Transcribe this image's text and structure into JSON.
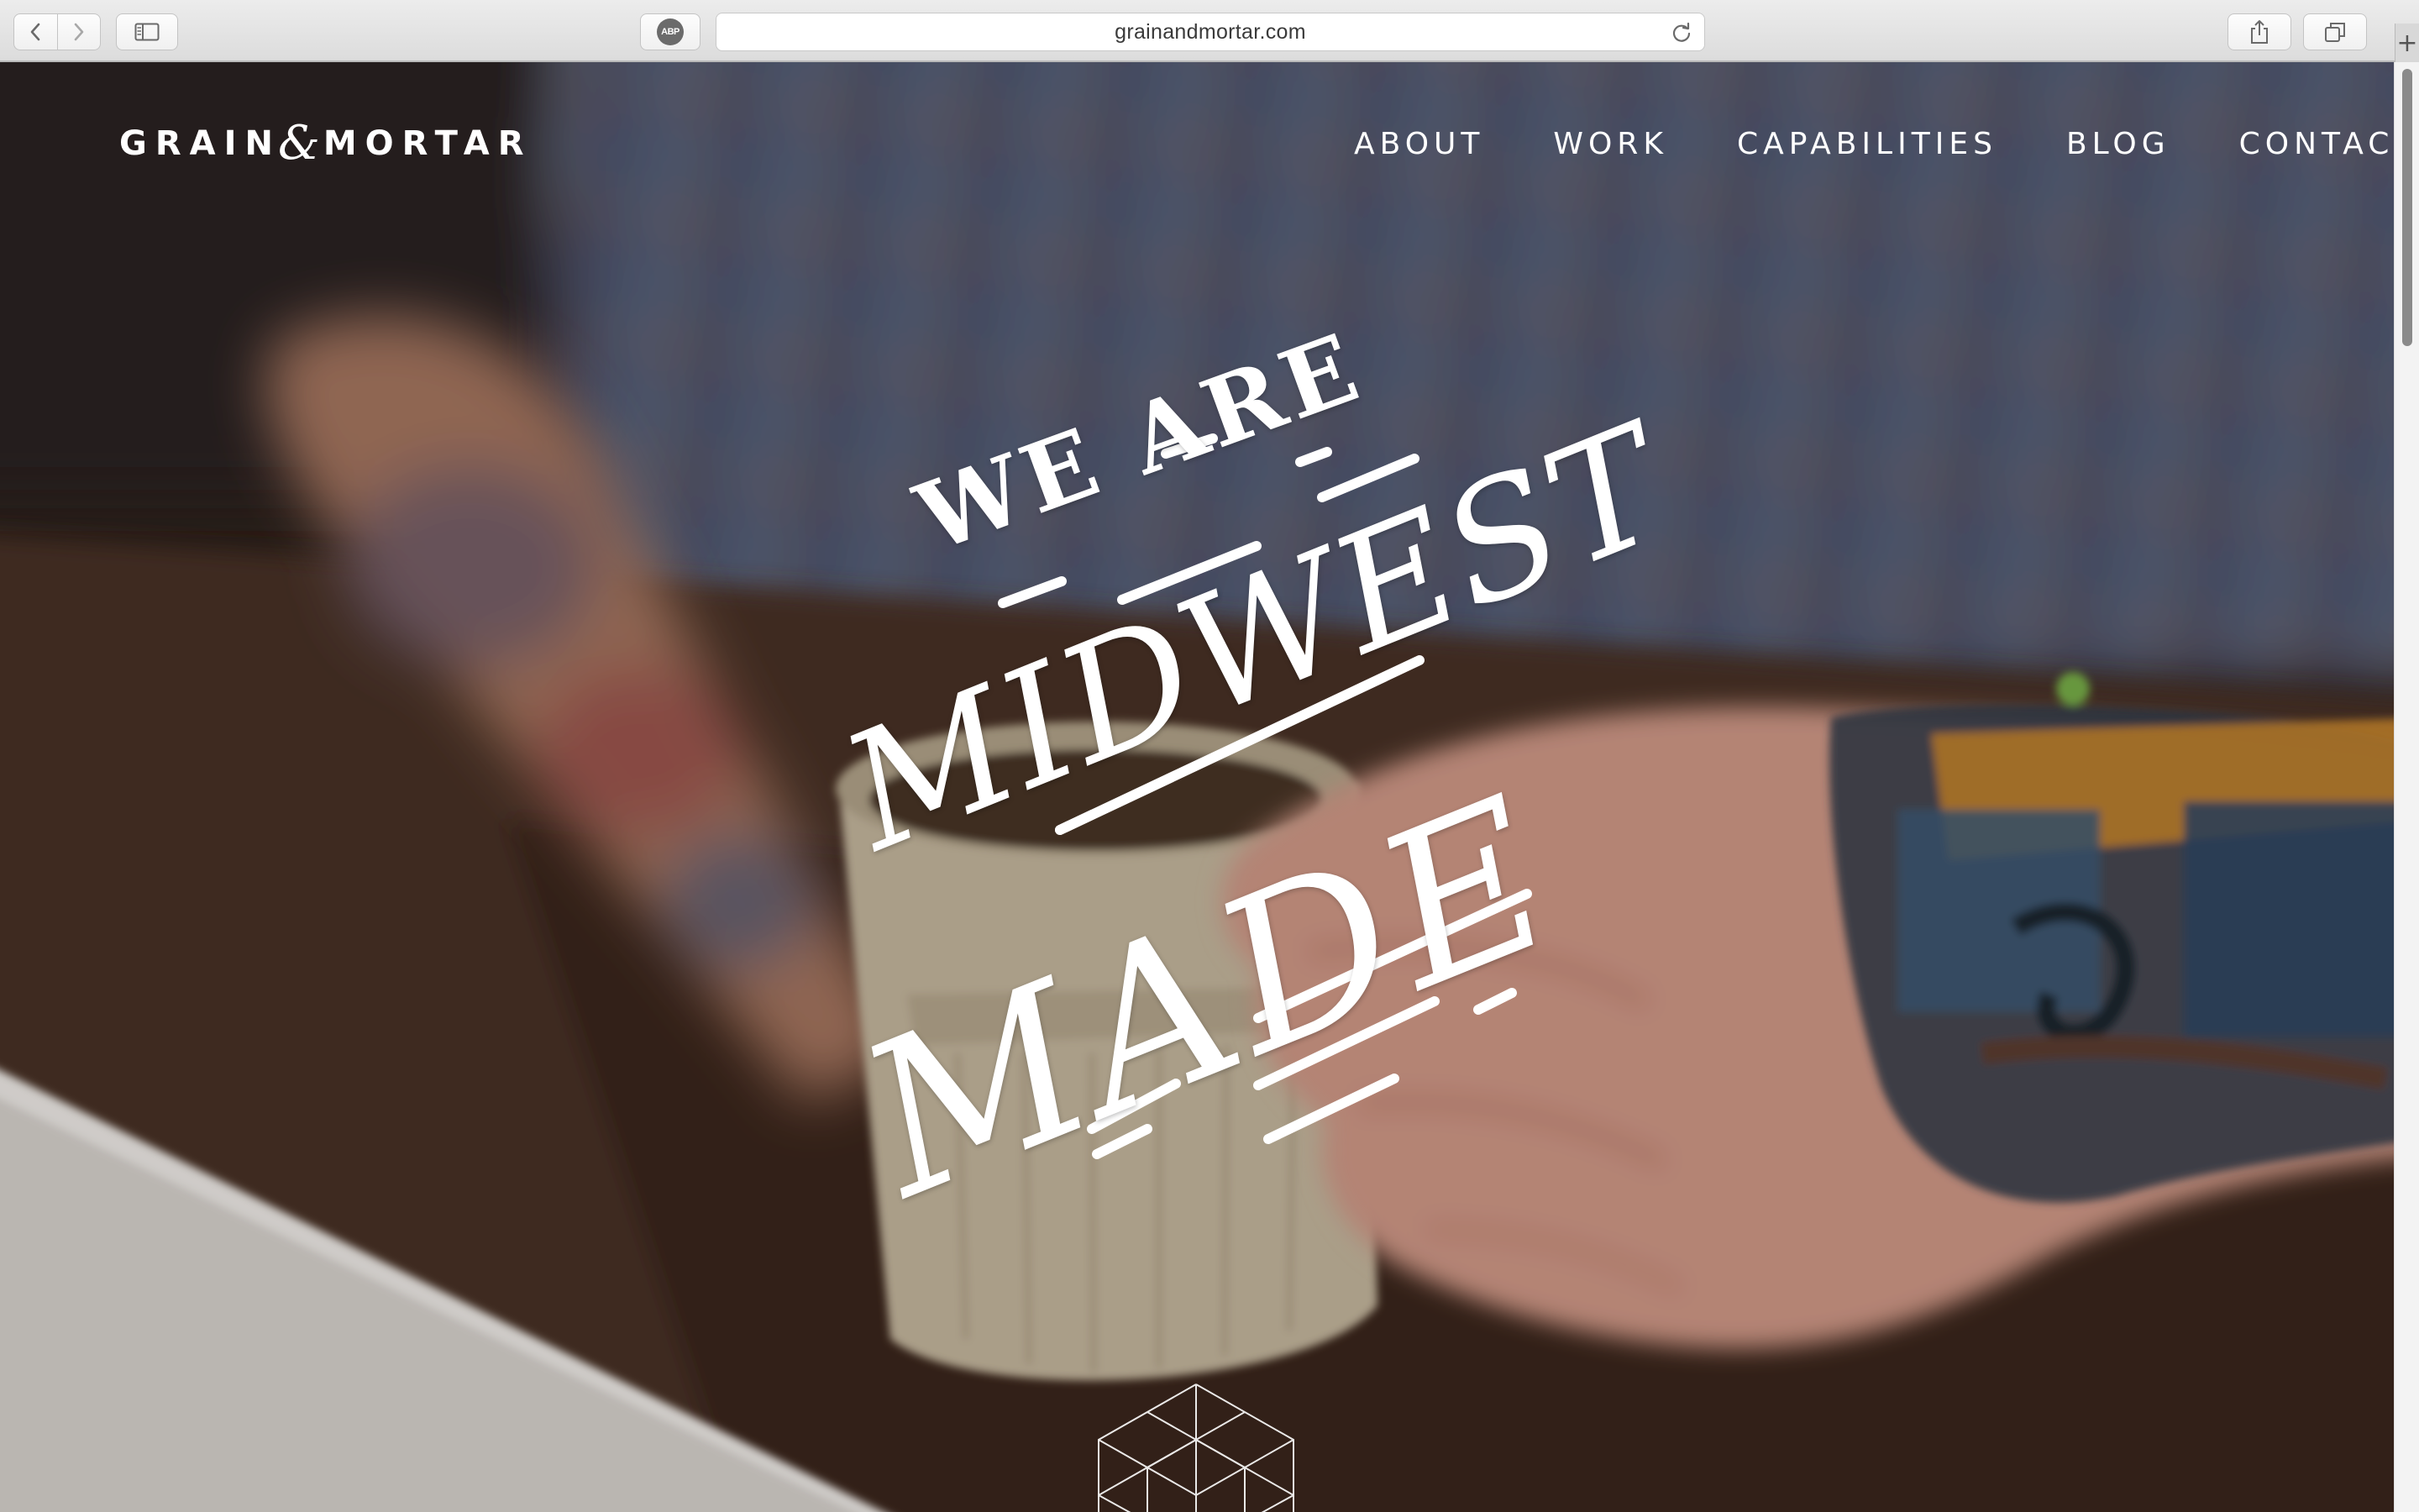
{
  "browser": {
    "url": "grainandmortar.com",
    "adblock_badge": "ABP",
    "newtab_symbol": "+",
    "icons": {
      "back": "chevron-left-icon",
      "forward": "chevron-right-icon",
      "sidebar": "sidebar-icon",
      "reload": "reload-icon",
      "share": "share-icon",
      "tabs": "tabs-overview-icon"
    }
  },
  "site": {
    "logo": {
      "left_word": "GRAIN",
      "amp": "&",
      "right_word": "MORTAR"
    },
    "nav": {
      "about": "ABOUT",
      "work": "WORK",
      "capabilities": "CAPABILITIES",
      "blog": "BLOG",
      "contact": "CONTACT"
    },
    "hero": {
      "line1": "WE ARE",
      "line2": "MIDWEST",
      "line3": "MADE"
    }
  },
  "colors": {
    "nav_text": "#ffffff",
    "toolbar": "#e3e3e3",
    "hero_base": "#3b2a20"
  }
}
